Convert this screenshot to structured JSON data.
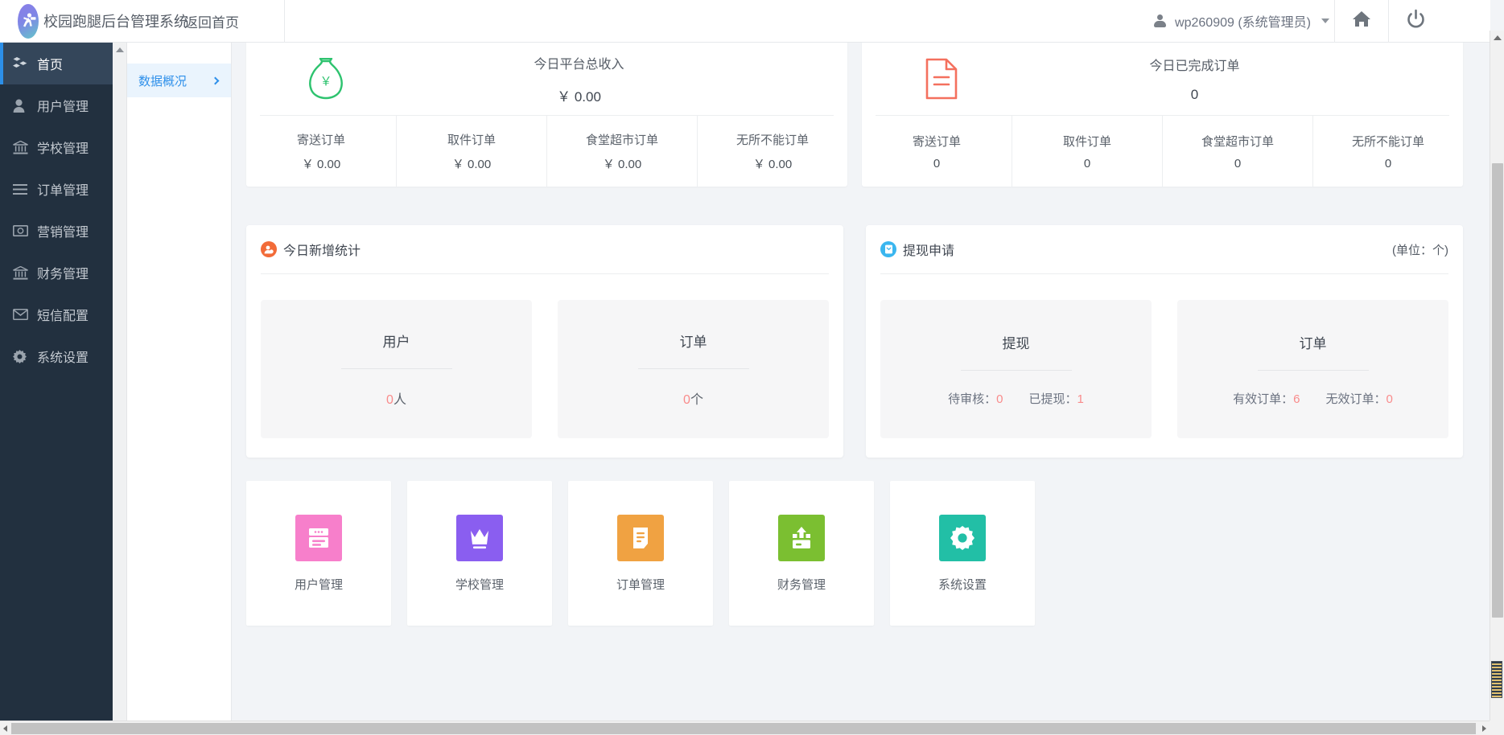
{
  "header": {
    "logo_icon": "runner-logo-icon",
    "brand_title": "校园跑腿后台管理系统",
    "home_link": "返回首页",
    "user_icon": "user-icon",
    "user_name": "wp260909 (系统管理员)",
    "home_icon": "home-icon",
    "power_icon": "power-icon"
  },
  "sidebar": {
    "items": [
      {
        "label": "首页",
        "icon": "blocks-icon",
        "active": true
      },
      {
        "label": "用户管理",
        "icon": "user-icon",
        "active": false
      },
      {
        "label": "学校管理",
        "icon": "bank-icon",
        "active": false
      },
      {
        "label": "订单管理",
        "icon": "list-icon",
        "active": false
      },
      {
        "label": "营销管理",
        "icon": "banknote-icon",
        "active": false
      },
      {
        "label": "财务管理",
        "icon": "bank-icon",
        "active": false
      },
      {
        "label": "短信配置",
        "icon": "envelope-icon",
        "active": false
      },
      {
        "label": "系统设置",
        "icon": "gear-icon",
        "active": false
      }
    ]
  },
  "subnav": {
    "item_label": "数据概况",
    "chevron": "chevron-right-icon"
  },
  "stats": {
    "income_card": {
      "icon": "money-bag-icon",
      "title": "今日平台总收入",
      "value": "￥ 0.00",
      "columns": [
        {
          "label": "寄送订单",
          "value": "￥ 0.00"
        },
        {
          "label": "取件订单",
          "value": "￥ 0.00"
        },
        {
          "label": "食堂超市订单",
          "value": "￥ 0.00"
        },
        {
          "label": "无所不能订单",
          "value": "￥ 0.00"
        }
      ]
    },
    "orders_card": {
      "icon": "document-icon",
      "title": "今日已完成订单",
      "value": "0",
      "columns": [
        {
          "label": "寄送订单",
          "value": "0"
        },
        {
          "label": "取件订单",
          "value": "0"
        },
        {
          "label": "食堂超市订单",
          "value": "0"
        },
        {
          "label": "无所不能订单",
          "value": "0"
        }
      ]
    }
  },
  "new_stats_panel": {
    "icon": "user-add-icon",
    "title": "今日新增统计",
    "cards": [
      {
        "title": "用户",
        "value_number": "0",
        "value_unit": "人"
      },
      {
        "title": "订单",
        "value_number": "0",
        "value_unit": "个"
      }
    ]
  },
  "withdraw_panel": {
    "icon": "withdraw-icon",
    "title": "提现申请",
    "unit": "(单位：个)",
    "cards": [
      {
        "title": "提现",
        "pairs": [
          {
            "label": "待审核：",
            "value": "0"
          },
          {
            "label": "已提现：",
            "value": "1"
          }
        ]
      },
      {
        "title": "订单",
        "pairs": [
          {
            "label": "有效订单：",
            "value": "6"
          },
          {
            "label": "无效订单：",
            "value": "0"
          }
        ]
      }
    ]
  },
  "shortcuts": [
    {
      "label": "用户管理",
      "icon": "user-card-icon",
      "color": "#f77fcb"
    },
    {
      "label": "学校管理",
      "icon": "crown-icon",
      "color": "#8a5ef0"
    },
    {
      "label": "订单管理",
      "icon": "order-doc-icon",
      "color": "#f0a242"
    },
    {
      "label": "财务管理",
      "icon": "money-up-icon",
      "color": "#7bbf31"
    },
    {
      "label": "系统设置",
      "icon": "gear-icon",
      "color": "#22bfa6"
    }
  ],
  "colors": {
    "sidebar_bg": "#22303f",
    "active_nav": "#34465a",
    "active_bar": "#2c8fe8",
    "accent_red": "#f98b8b",
    "income_green": "#2ec36f",
    "orders_red": "#f4705e",
    "link_blue": "#2f90ea"
  }
}
